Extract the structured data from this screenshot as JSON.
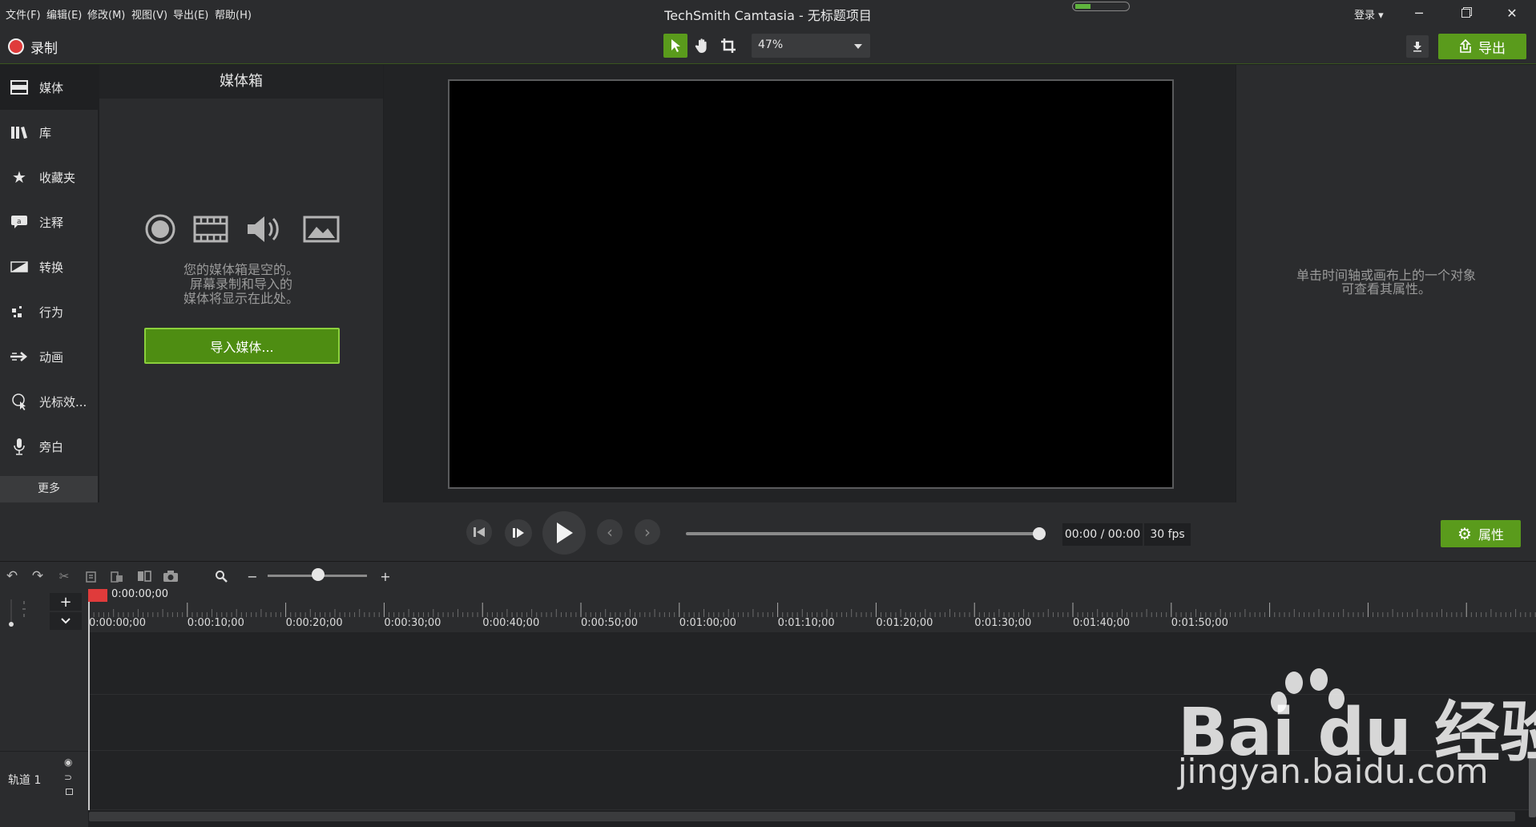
{
  "window": {
    "title": "TechSmith Camtasia - 无标题项目",
    "login": "登录",
    "battery_level": 0.3
  },
  "menu": [
    "文件(F)",
    "编辑(E)",
    "修改(M)",
    "视图(V)",
    "导出(E)",
    "帮助(H)"
  ],
  "toolbar": {
    "record": "录制",
    "zoom": "47%",
    "export": "导出"
  },
  "sidebar": {
    "items": [
      {
        "label": "媒体",
        "icon": "film-icon"
      },
      {
        "label": "库",
        "icon": "library-icon"
      },
      {
        "label": "收藏夹",
        "icon": "star-icon"
      },
      {
        "label": "注释",
        "icon": "annotation-icon"
      },
      {
        "label": "转换",
        "icon": "transition-icon"
      },
      {
        "label": "行为",
        "icon": "behavior-icon"
      },
      {
        "label": "动画",
        "icon": "animation-icon"
      },
      {
        "label": "光标效...",
        "icon": "cursor-effect-icon"
      },
      {
        "label": "旁白",
        "icon": "microphone-icon"
      }
    ],
    "more": "更多"
  },
  "media_bin": {
    "title": "媒体箱",
    "empty_lines": [
      "您的媒体箱是空的。",
      "屏幕录制和导入的",
      "媒体将显示在此处。"
    ],
    "import": "导入媒体..."
  },
  "properties": {
    "empty_lines": [
      "单击时间轴或画布上的一个对象",
      "可查看其属性。"
    ],
    "button": "属性"
  },
  "player": {
    "time": "00:00 / 00:00",
    "fps": "30 fps",
    "progress": 1.0
  },
  "timeline": {
    "playhead_time": "0:00:00;00",
    "ticks": [
      "0:00:00;00",
      "0:00:10;00",
      "0:00:20;00",
      "0:00:30;00",
      "0:00:40;00",
      "0:00:50;00",
      "0:01:00;00",
      "0:01:10;00",
      "0:01:20;00",
      "0:01:30;00",
      "0:01:40;00",
      "0:01:50;00"
    ],
    "track_label": "轨道 1"
  },
  "watermark": {
    "brand": "Bai  du 经验",
    "url": "jingyan.baidu.com"
  },
  "colors": {
    "accent": "#5a9b1c",
    "record": "#e03b3b",
    "bg": "#2b2c2e"
  }
}
